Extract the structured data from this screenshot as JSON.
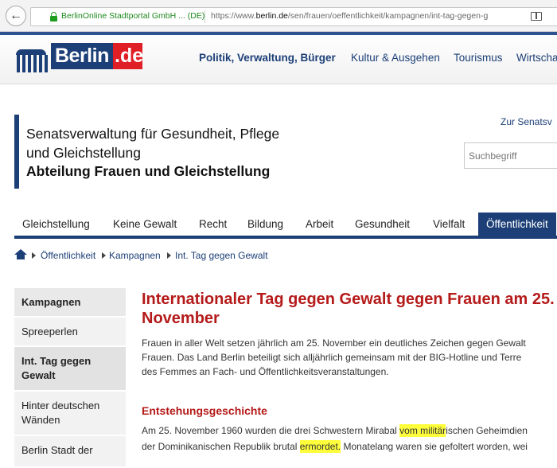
{
  "browser": {
    "back_label": "←",
    "identity": "BerlinOnline Stadtportal GmbH ... (DE)",
    "url_prefix": "https://www.",
    "url_domain": "berlin.de",
    "url_path": "/sen/frauen/oeffentlichkeit/kampagnen/int-tag-gegen-g"
  },
  "site": {
    "logo_word": "Berlin",
    "logo_tld": ".de",
    "top_nav": [
      "Politik, Verwaltung, Bürger",
      "Kultur & Ausgehen",
      "Tourismus",
      "Wirtscha"
    ]
  },
  "department": {
    "line1": "Senatsverwaltung für Gesundheit, Pflege",
    "line2": "und Gleichstellung",
    "line3": "Abteilung Frauen und Gleichstellung"
  },
  "header_link": "Zur Senatsv",
  "search": {
    "placeholder": "Suchbegriff"
  },
  "main_nav": [
    "Gleichstellung",
    "Keine Gewalt",
    "Recht",
    "Bildung",
    "Arbeit",
    "Gesundheit",
    "Vielfalt",
    "Öffentlichkeit"
  ],
  "breadcrumb": [
    "Öffentlichkeit",
    "Kampagnen",
    "Int. Tag gegen Gewalt"
  ],
  "sidebar": {
    "heading": "Kampagnen",
    "items": [
      "Spreeperlen",
      "Int. Tag gegen Gewalt",
      "Hinter deutschen Wänden",
      "Berlin Stadt der"
    ]
  },
  "content": {
    "title": "Internationaler Tag gegen Gewalt gegen Frauen am 25. November",
    "intro": [
      "Frauen in aller Welt setzen jährlich am 25. November ein deutliches Zeichen gegen Gewalt",
      "Frauen. Das Land Berlin beteiligt sich alljährlich gemeinsam mit der BIG-Hotline und Terre",
      "des Femmes an Fach- und Öffentlichkeitsveranstaltungen."
    ],
    "section_title": "Entstehungsgeschichte",
    "history_1a": "Am 25. November 1960 wurden die drei Schwestern Mirabal ",
    "history_1_hl": "vom militär",
    "history_1b": "ischen Geheimdien",
    "history_2a": "der Dominikanischen Republik brutal ",
    "history_2_hl": "ermordet.",
    "history_2b": " Monatelang waren sie gefoltert worden, wei"
  }
}
